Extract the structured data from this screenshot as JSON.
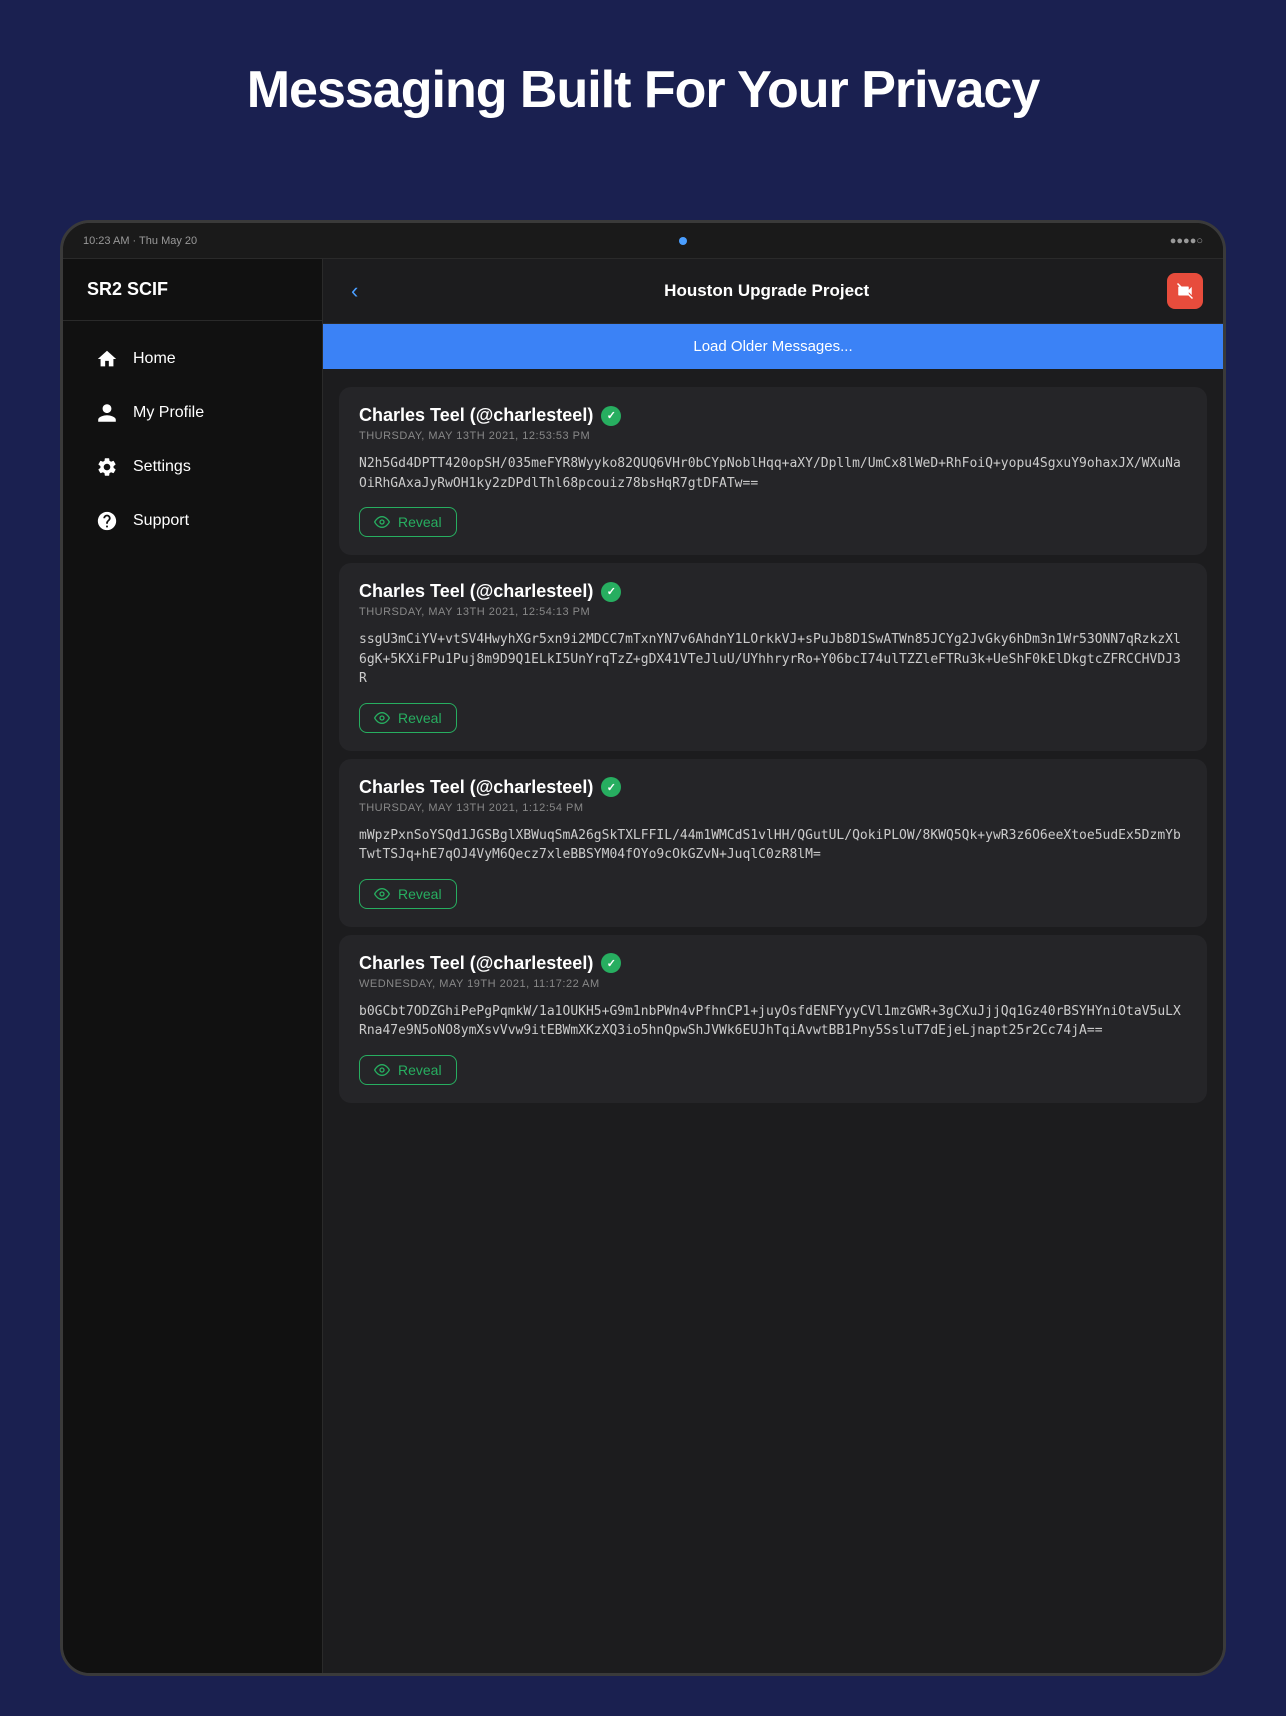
{
  "page": {
    "headline": "Messaging Built For Your Privacy"
  },
  "device": {
    "status_bar": {
      "time": "10:23 AM · Thu May 20",
      "signal": "●●●●○"
    }
  },
  "sidebar": {
    "title": "SR2 SCIF",
    "nav_items": [
      {
        "id": "home",
        "label": "Home",
        "icon": "home"
      },
      {
        "id": "my-profile",
        "label": "My Profile",
        "icon": "profile"
      },
      {
        "id": "settings",
        "label": "Settings",
        "icon": "settings"
      },
      {
        "id": "support",
        "label": "Support",
        "icon": "support"
      }
    ]
  },
  "chat": {
    "title": "Houston Upgrade Project",
    "back_label": "‹",
    "load_more_label": "Load Older Messages...",
    "messages": [
      {
        "id": 1,
        "sender": "Charles Teel (@charlesteel)",
        "verified": true,
        "timestamp": "THURSDAY, MAY 13TH 2021, 12:53:53 PM",
        "body": "N2h5Gd4DPTT420opSH/035meFYR8Wyyko82QUQ6VHr0bCYpNoblHqq+aXY/Dpllm/UmCx8lWeD+RhFoiQ+yopu4SgxuY9ohaxJX/WXuNaOiRhGAxaJyRwOH1ky2zDPdlThl68pcouiz78bsHqR7gtDFATw==",
        "reveal_label": "Reveal"
      },
      {
        "id": 2,
        "sender": "Charles Teel (@charlesteel)",
        "verified": true,
        "timestamp": "THURSDAY, MAY 13TH 2021, 12:54:13 PM",
        "body": "ssgU3mCiYV+vtSV4HwyhXGr5xn9i2MDCC7mTxnYN7v6AhdnY1LOrkkVJ+sPuJb8D1SwATWn85JCYg2JvGky6hDm3n1Wr53ONN7qRzkzXl6gK+5KXiFPu1Puj8m9D9Q1ELkI5UnYrqTzZ+gDX41VTeJluU/UYhhryrRo+Y06bcI74ulTZZleFTRu3k+UeShF0kElDkgtcZFRCCHVDJ3R",
        "reveal_label": "Reveal"
      },
      {
        "id": 3,
        "sender": "Charles Teel (@charlesteel)",
        "verified": true,
        "timestamp": "THURSDAY, MAY 13TH 2021, 1:12:54 PM",
        "body": "mWpzPxnSoYSQd1JGSBglXBWuqSmA26gSkTXLFFIL/44m1WMCdS1vlHH/QGutUL/QokiPLOW/8KWQ5Qk+ywR3z6O6eeXtoe5udEx5DzmYbTwtTSJq+hE7qOJ4VyM6Qecz7xleBBSYM04fOYo9cOkGZvN+JuqlC0zR8lM=",
        "reveal_label": "Reveal"
      },
      {
        "id": 4,
        "sender": "Charles Teel (@charlesteel)",
        "verified": true,
        "timestamp": "WEDNESDAY, MAY 19TH 2021, 11:17:22 AM",
        "body": "b0GCbt7ODZGhiPePgPqmkW/1a1OUKH5+G9m1nbPWn4vPfhnCP1+juyOsfdENFYyyCVl1mzGWR+3gCXuJjjQq1Gz40rBSYHYniOtaV5uLXRna47e9N5oNO8ymXsvVvw9itEBWmXKzXQ3io5hnQpwShJVWk6EUJhTqiAvwtBB1Pny5SsluT7dEjeLjnapt25r2Cc74jA==",
        "reveal_label": "Reveal"
      }
    ]
  }
}
